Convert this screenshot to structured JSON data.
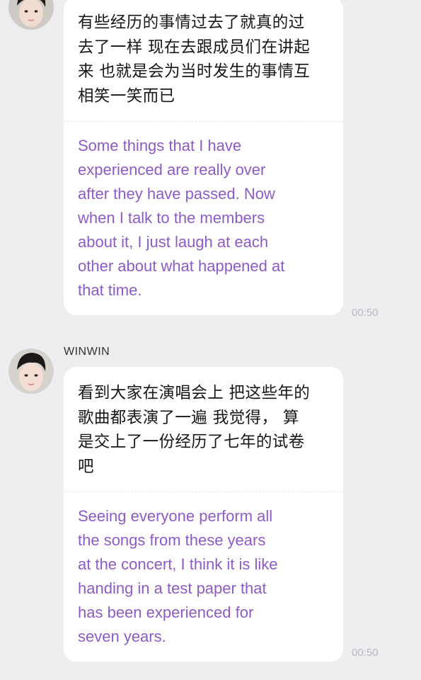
{
  "messages": [
    {
      "sender": "",
      "avatar_icon": "avatar-photo-icon",
      "chinese_text": "有些经历的事情过去了就真的过去了一样 现在去跟成员们在讲起来 也就是会为当时发生的事情互相笑一笑而已",
      "chinese_lines": [
        "有些经历的事情过去了就真的过",
        "去了一样 现在去跟成员们在讲起",
        "来 也就是会为当时发生的事情互",
        "相笑一笑而已"
      ],
      "english_lines": [
        "Some things that I have",
        "experienced are really over",
        "after they have passed. Now",
        "when I talk to the members",
        "about it, I just laugh at each",
        "other about what happened at",
        "that time."
      ],
      "time": "00:50"
    },
    {
      "sender": "WINWIN",
      "avatar_icon": "avatar-photo-icon",
      "chinese_lines": [
        "看到大家在演唱会上 把这些年的",
        "歌曲都表演了一遍 我觉得， 算",
        "是交上了一份经历了七年的试卷",
        "吧"
      ],
      "english_lines": [
        "Seeing everyone perform all",
        "the songs from these years",
        "at the concert, I think it is like",
        "handing in a test paper that",
        "has been experienced for",
        "seven years."
      ],
      "time": "00:50"
    }
  ],
  "colors": {
    "background": "#eeeef1",
    "bubble": "#ffffff",
    "translation_text": "#8e5bc6",
    "original_text": "#161616",
    "timestamp": "#b9b9be"
  }
}
